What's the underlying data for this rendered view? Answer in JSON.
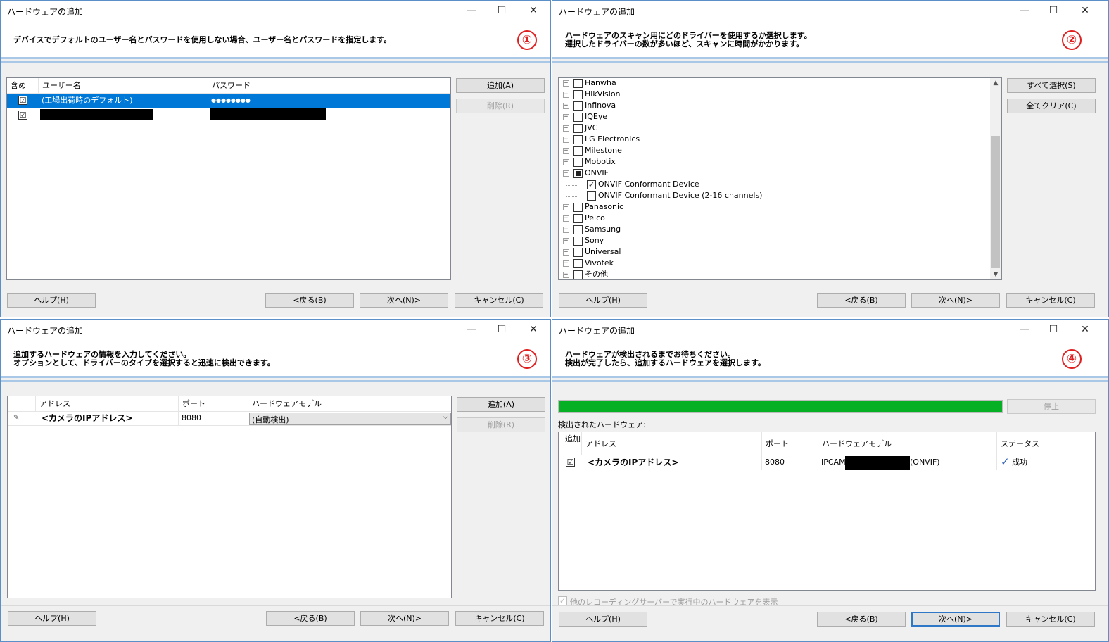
{
  "w1": {
    "title": "ハードウェアの追加",
    "header": "デバイスでデフォルトのユーザー名とパスワードを使用しない場合、ユーザー名とパスワードを指定します。",
    "step": "①",
    "columns": [
      "含め",
      "ユーザー名",
      "パスワード"
    ],
    "rows": [
      {
        "checked": "☑",
        "user": "(工場出荷時のデフォルト)",
        "password": "●●●●●●●●"
      },
      {
        "checked": "☑",
        "user": "",
        "password": ""
      }
    ],
    "add": "追加(A)",
    "delete": "削除(R)",
    "help": "ヘルプ(H)",
    "back": "<戻る(B)",
    "next": "次へ(N)>",
    "cancel": "キャンセル(C)"
  },
  "w2": {
    "title": "ハードウェアの追加",
    "header1": "ハードウェアのスキャン用にどのドライバーを使用するか選択します。",
    "header2": "選択したドライバーの数が多いほど、スキャンに時間がかかります。",
    "step": "②",
    "drivers": [
      {
        "label": "Hanwha",
        "state": "unchecked"
      },
      {
        "label": "HikVision",
        "state": "unchecked"
      },
      {
        "label": "Infinova",
        "state": "unchecked"
      },
      {
        "label": "IQEye",
        "state": "unchecked"
      },
      {
        "label": "JVC",
        "state": "unchecked"
      },
      {
        "label": "LG Electronics",
        "state": "unchecked"
      },
      {
        "label": "Milestone",
        "state": "unchecked"
      },
      {
        "label": "Mobotix",
        "state": "unchecked"
      },
      {
        "label": "ONVIF",
        "state": "indeterminate",
        "expanded": true
      },
      {
        "label": "ONVIF Conformant Device",
        "state": "checked",
        "child": true
      },
      {
        "label": "ONVIF Conformant Device (2-16 channels)",
        "state": "unchecked",
        "child": true
      },
      {
        "label": "Panasonic",
        "state": "unchecked"
      },
      {
        "label": "Pelco",
        "state": "unchecked"
      },
      {
        "label": "Samsung",
        "state": "unchecked"
      },
      {
        "label": "Sony",
        "state": "unchecked"
      },
      {
        "label": "Universal",
        "state": "unchecked"
      },
      {
        "label": "Vivotek",
        "state": "unchecked"
      },
      {
        "label": "その他",
        "state": "unchecked"
      }
    ],
    "select_all": "すべて選択(S)",
    "clear_all": "全てクリア(C)",
    "help": "ヘルプ(H)",
    "back": "<戻る(B)",
    "next": "次へ(N)>",
    "cancel": "キャンセル(C)"
  },
  "w3": {
    "title": "ハードウェアの追加",
    "header1": "追加するハードウェアの情報を入力してください。",
    "header2": "オプションとして、ドライバーのタイプを選択すると迅速に検出できます。",
    "step": "③",
    "columns": [
      "アドレス",
      "ポート",
      "ハードウェアモデル"
    ],
    "row": {
      "address": "<カメラのIPアドレス>",
      "port": "8080",
      "model": "(自動検出)"
    },
    "add": "追加(A)",
    "delete": "削除(R)",
    "help": "ヘルプ(H)",
    "back": "<戻る(B)",
    "next": "次へ(N)>",
    "cancel": "キャンセル(C)"
  },
  "w4": {
    "title": "ハードウェアの追加",
    "header1": "ハードウェアが検出されるまでお待ちください。",
    "header2": "検出が完了したら、追加するハードウェアを選択します。",
    "step": "④",
    "progress": 1.0,
    "stop": "停止",
    "found_label": "検出されたハードウェア:",
    "columns": [
      "追加",
      "アドレス",
      "ポート",
      "ハードウェアモデル",
      "ステータス"
    ],
    "row": {
      "checked": "☑",
      "address": "<カメラのIPアドレス>",
      "port": "8080",
      "model_prefix": "IPCAM",
      "model_suffix": "(ONVIF)",
      "status": "成功"
    },
    "show_other": "他のレコーディングサーバーで実行中のハードウェアを表示",
    "help": "ヘルプ(H)",
    "back": "<戻る(B)",
    "next": "次へ(N)>",
    "cancel": "キャンセル(C)"
  },
  "colors": {
    "progress": "#06b025",
    "step": "#e02020",
    "selection": "#0078d7"
  },
  "titlebar_glyphs": {
    "minimize": "—",
    "maximize": "☐",
    "close": "✕"
  }
}
